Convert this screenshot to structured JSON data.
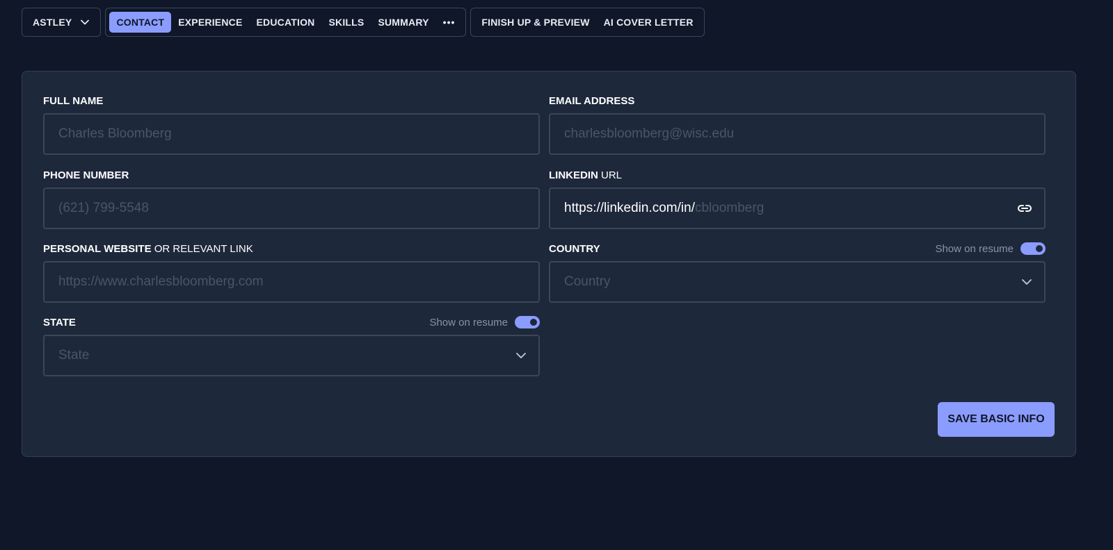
{
  "nav": {
    "profile": "ASTLEY",
    "tabs": [
      "CONTACT",
      "EXPERIENCE",
      "EDUCATION",
      "SKILLS",
      "SUMMARY"
    ],
    "more": "•••",
    "finish": "FINISH UP & PREVIEW",
    "cover": "AI COVER LETTER"
  },
  "form": {
    "full_name": {
      "label": "FULL NAME",
      "placeholder": "Charles Bloomberg"
    },
    "email": {
      "label": "EMAIL ADDRESS",
      "placeholder": "charlesbloomberg@wisc.edu"
    },
    "phone": {
      "label": "PHONE NUMBER",
      "placeholder": "(621) 799-5548"
    },
    "linkedin": {
      "label_bold": "LINKEDIN",
      "label_normal": " URL",
      "value": "https://linkedin.com/in/",
      "placeholder": "cbloomberg"
    },
    "website": {
      "label_bold": "PERSONAL WEBSITE",
      "label_normal": " OR RELEVANT LINK",
      "placeholder": "https://www.charlesbloomberg.com"
    },
    "country": {
      "label": "COUNTRY",
      "toggle_text": "Show on resume",
      "placeholder": "Country"
    },
    "state": {
      "label": "STATE",
      "toggle_text": "Show on resume",
      "placeholder": "State"
    },
    "save": "SAVE BASIC INFO"
  },
  "colors": {
    "accent": "#8b9cff",
    "background": "#0f1729",
    "panel": "#1e283b"
  }
}
